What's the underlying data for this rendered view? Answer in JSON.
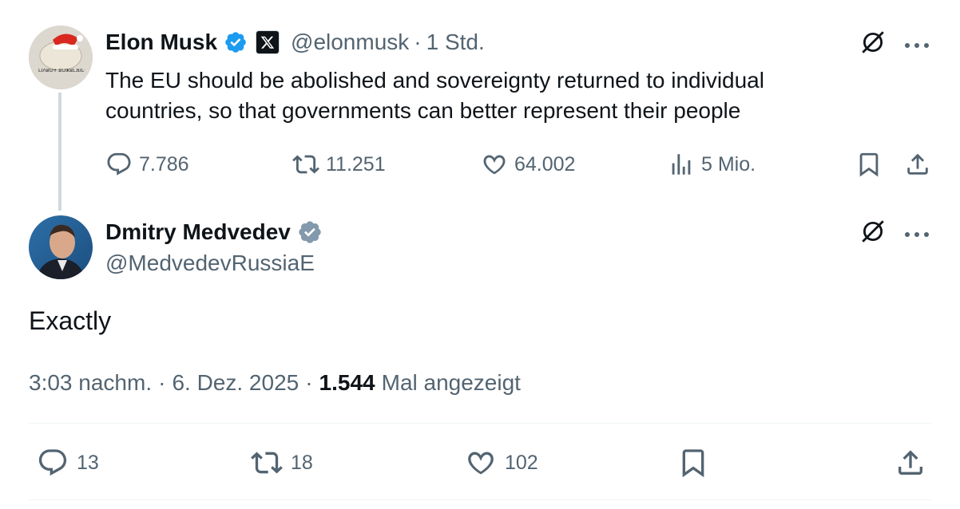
{
  "parent_tweet": {
    "author_name": "Elon Musk",
    "handle": "@elonmusk",
    "separator": "·",
    "time": "1 Std.",
    "text_line1": "The EU should be abolished and sovereignty returned to individual",
    "text_line2": "countries, so that governments can better represent their people",
    "avatar_caption": "ⵎⵏⴷⵓⵙⵜ ⴻⵔⵣⵓⵎⴼⵏⵎⵔⵉ",
    "stats": {
      "replies": "7.786",
      "reposts": "11.251",
      "likes": "64.002",
      "views": "5 Mio."
    }
  },
  "main_tweet": {
    "author_name": "Dmitry Medvedev",
    "handle": "@MedvedevRussiaE",
    "text": "Exactly",
    "time": "3:03 nachm.",
    "date": "6. Dez. 2025",
    "views_count": "1.544",
    "views_label": "Mal angezeigt",
    "sep1": "·",
    "sep2": "·",
    "stats": {
      "replies": "13",
      "reposts": "18",
      "likes": "102"
    }
  },
  "colors": {
    "verified_blue": "#1d9bf0",
    "verified_gray": "#829aab",
    "muted": "#536471",
    "text": "#0f1419"
  }
}
